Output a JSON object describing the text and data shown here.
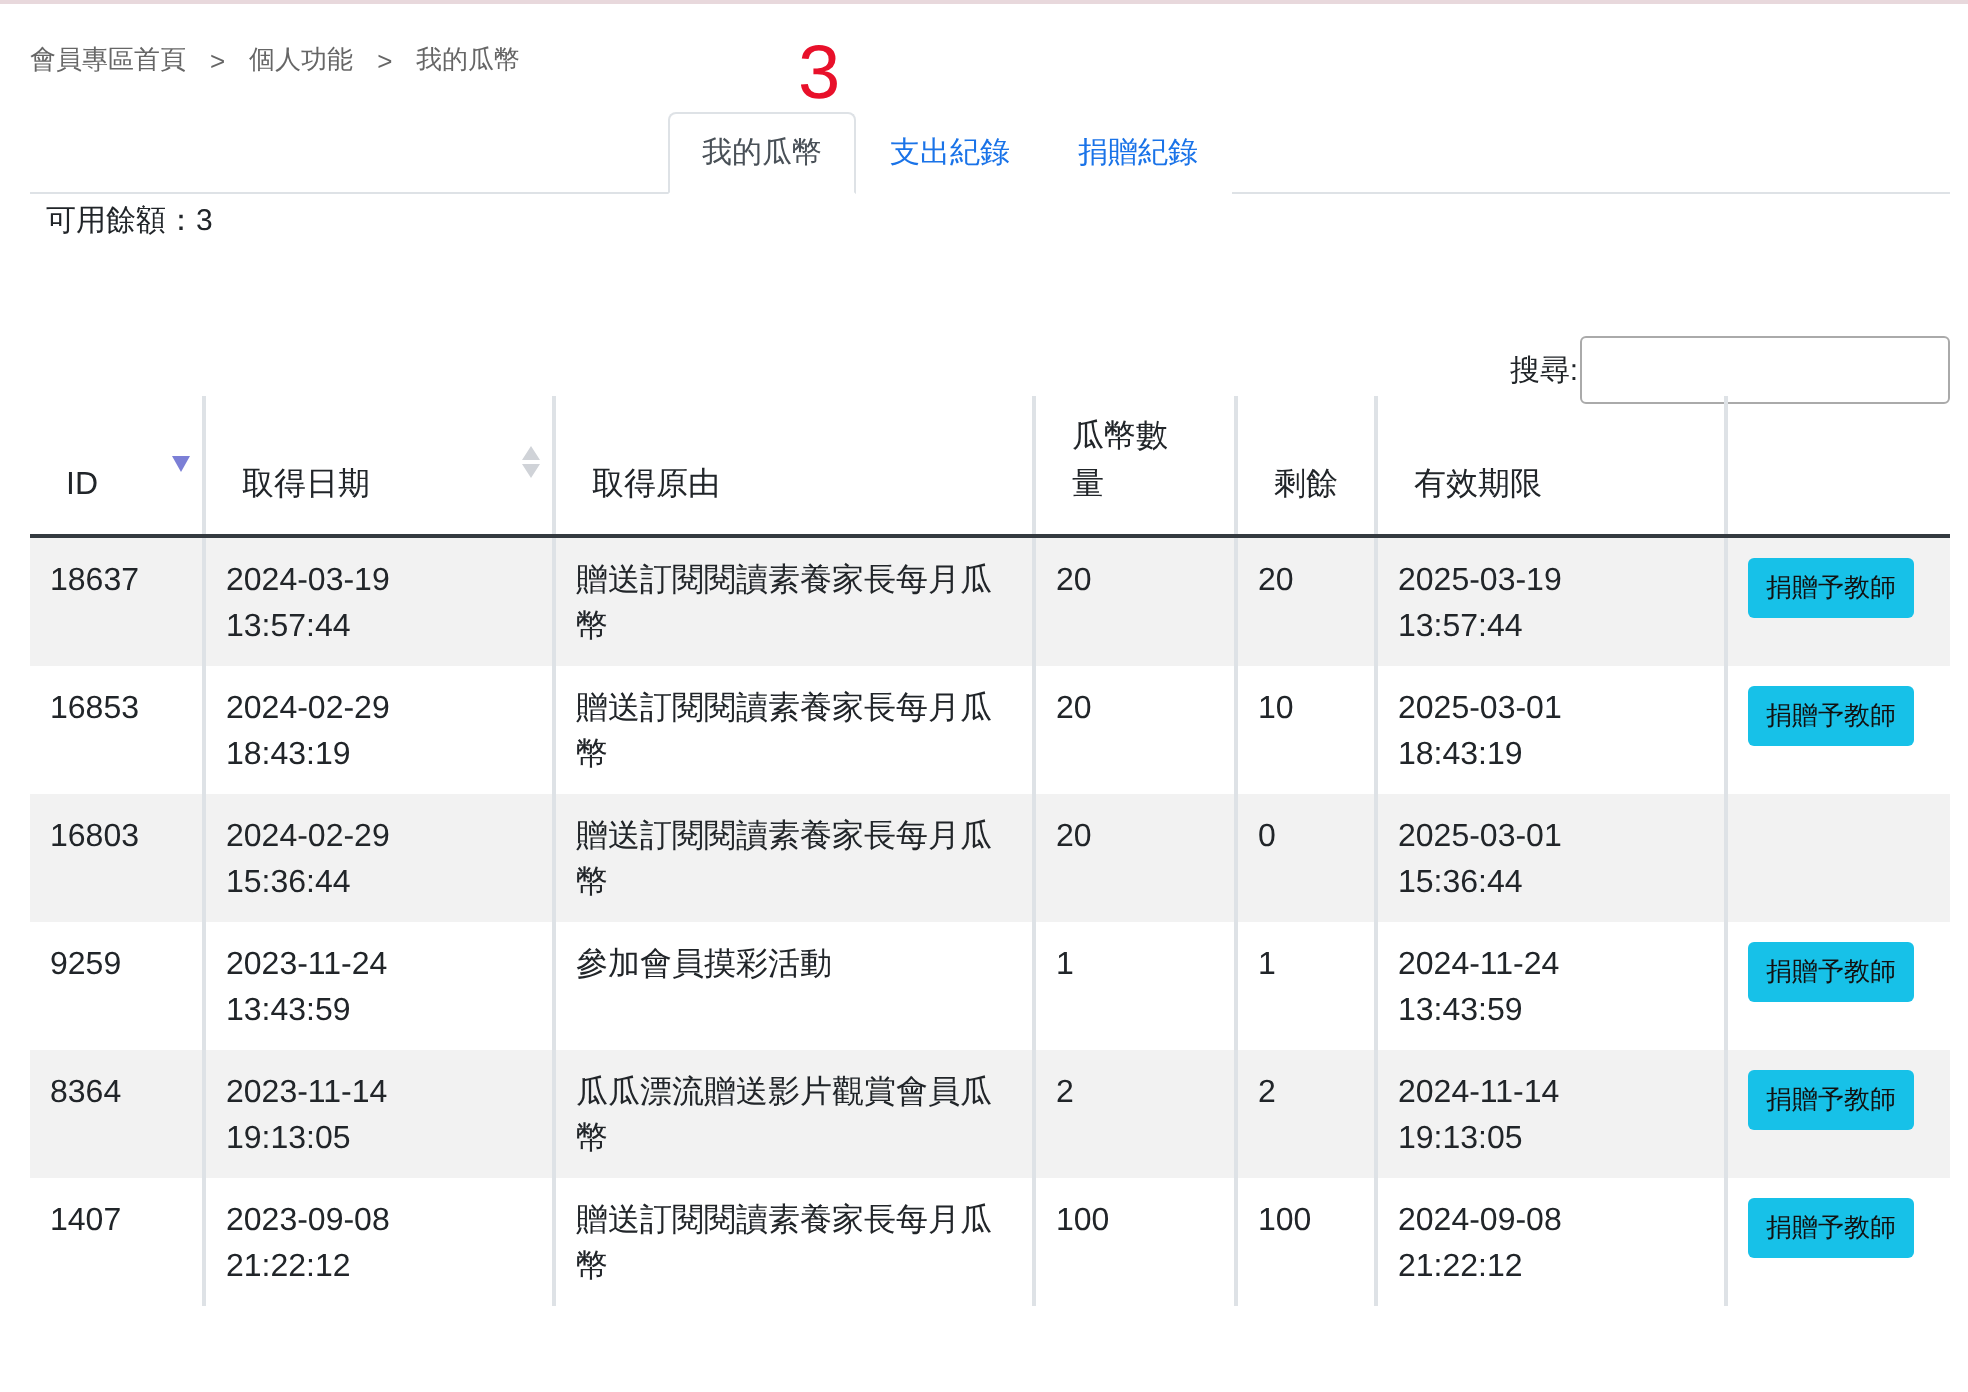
{
  "breadcrumb": [
    "會員專區首頁",
    "個人功能",
    "我的瓜幣"
  ],
  "breadcrumb_separator": ">",
  "annotation": "3",
  "tabs": [
    {
      "label": "我的瓜幣",
      "selected": true
    },
    {
      "label": "支出紀錄",
      "selected": false
    },
    {
      "label": "捐贈紀錄",
      "selected": false
    }
  ],
  "balance": "可用餘額：3",
  "search": {
    "label": "搜尋:"
  },
  "table": {
    "columns": [
      {
        "label": "ID",
        "sorted": true
      },
      {
        "label": "取得日期",
        "sorted": false
      },
      {
        "label": "取得原由"
      },
      {
        "label": "瓜幣數量"
      },
      {
        "label": "剩餘"
      },
      {
        "label": "有效期限"
      },
      {}
    ],
    "rows": [
      {
        "id": "18637",
        "date": "2024-03-19 13:57:44",
        "reason": "贈送訂閱閱讀素養家長每月瓜幣",
        "amount": "20",
        "remaining": "20",
        "expiry": "2025-03-19 13:57:44",
        "action": "捐贈予教師"
      },
      {
        "id": "16853",
        "date": "2024-02-29 18:43:19",
        "reason": "贈送訂閱閱讀素養家長每月瓜幣",
        "amount": "20",
        "remaining": "10",
        "expiry": "2025-03-01 18:43:19",
        "action": "捐贈予教師"
      },
      {
        "id": "16803",
        "date": "2024-02-29 15:36:44",
        "reason": "贈送訂閱閱讀素養家長每月瓜幣",
        "amount": "20",
        "remaining": "0",
        "expiry": "2025-03-01 15:36:44"
      },
      {
        "id": "9259",
        "date": "2023-11-24 13:43:59",
        "reason": "參加會員摸彩活動",
        "amount": "1",
        "remaining": "1",
        "expiry": "2024-11-24 13:43:59",
        "action": "捐贈予教師"
      },
      {
        "id": "8364",
        "date": "2023-11-14 19:13:05",
        "reason": "瓜瓜漂流贈送影片觀賞會員瓜幣",
        "amount": "2",
        "remaining": "2",
        "expiry": "2024-11-14 19:13:05",
        "action": "捐贈予教師"
      },
      {
        "id": "1407",
        "date": "2023-09-08 21:22:12",
        "reason": "贈送訂閱閱讀素養家長每月瓜幣",
        "amount": "100",
        "remaining": "100",
        "expiry": "2024-09-08 21:22:12",
        "action": "捐贈予教師"
      }
    ]
  }
}
